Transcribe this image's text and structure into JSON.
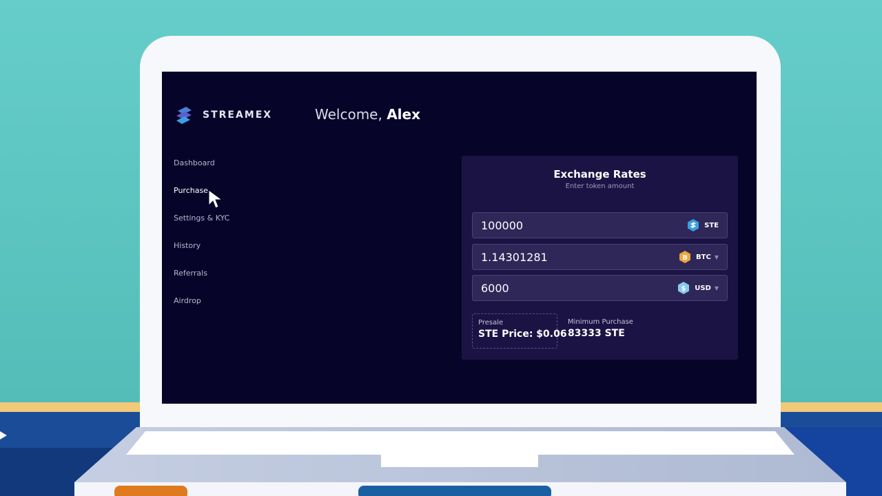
{
  "app": {
    "brand": "STREAMEX",
    "welcome_prefix": "Welcome,",
    "user_name": "Alex"
  },
  "sidebar": {
    "items": [
      {
        "label": "Dashboard"
      },
      {
        "label": "Purchase",
        "active": true
      },
      {
        "label": "Settings & KYC"
      },
      {
        "label": "History"
      },
      {
        "label": "Referrals"
      },
      {
        "label": "Airdrop"
      }
    ]
  },
  "exchange": {
    "title": "Exchange Rates",
    "subtitle": "Enter token amount",
    "fields": [
      {
        "value": "100000",
        "currency": "STE",
        "icon": "ste-coin-icon",
        "has_dropdown": false
      },
      {
        "value": "1.14301281",
        "currency": "BTC",
        "icon": "btc-coin-icon",
        "has_dropdown": true
      },
      {
        "value": "6000",
        "currency": "USD",
        "icon": "usd-coin-icon",
        "has_dropdown": true
      }
    ],
    "presale_label": "Presale",
    "presale_price": "STE Price: $0.06",
    "min_label": "Minimum Purchase",
    "min_value": "83333 STE"
  },
  "colors": {
    "screen_bg": "#07042a",
    "card_bg": "#1b1344",
    "field_bg": "#2e2758",
    "btc": "#f0a63a",
    "ste": "#3aa0e0",
    "usd": "#8cc8f0"
  }
}
